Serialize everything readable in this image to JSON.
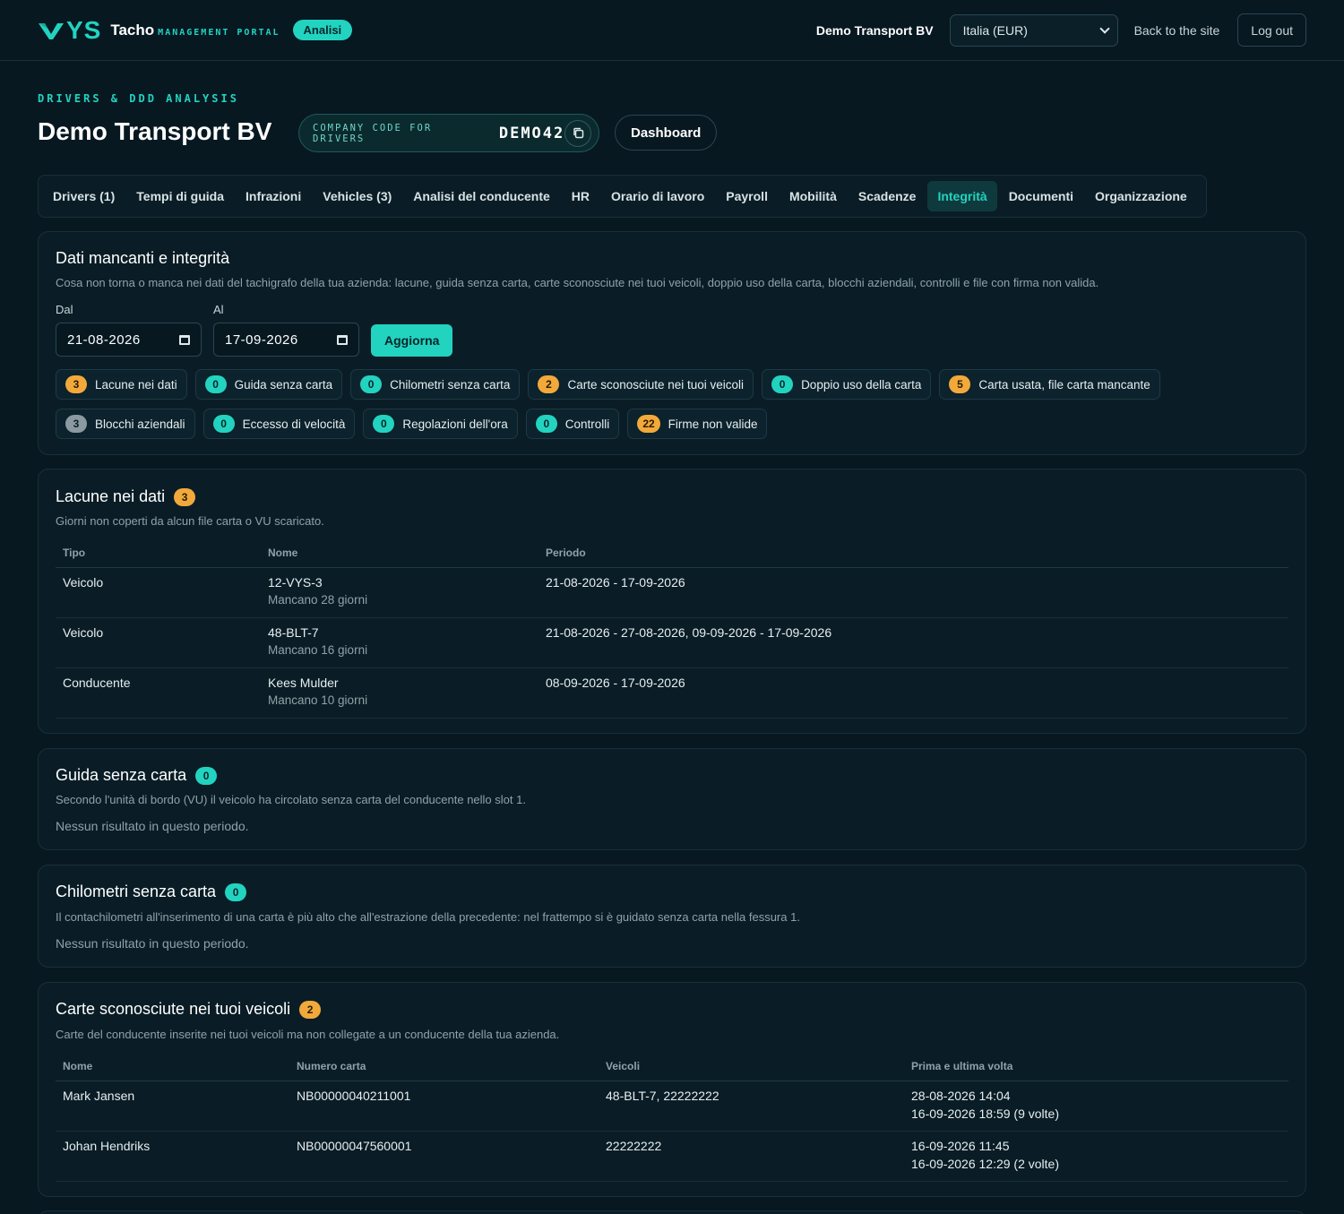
{
  "topbar": {
    "logo_text": "YS",
    "brand_name": "Tacho",
    "brand_sub": "MANAGEMENT PORTAL",
    "mode_pill": "Analisi",
    "company": "Demo Transport BV",
    "region_select": "Italia (EUR)",
    "back_link": "Back to the site",
    "logout": "Log out"
  },
  "header": {
    "eyebrow": "DRIVERS & DDD ANALYSIS",
    "title": "Demo Transport BV",
    "code_label": "COMPANY CODE FOR DRIVERS",
    "code_value": "DEMO42",
    "dashboard_button": "Dashboard"
  },
  "tabs": [
    {
      "label": "Drivers (1)",
      "active": false
    },
    {
      "label": "Tempi di guida",
      "active": false
    },
    {
      "label": "Infrazioni",
      "active": false
    },
    {
      "label": "Vehicles (3)",
      "active": false
    },
    {
      "label": "Analisi del conducente",
      "active": false
    },
    {
      "label": "HR",
      "active": false
    },
    {
      "label": "Orario di lavoro",
      "active": false
    },
    {
      "label": "Payroll",
      "active": false
    },
    {
      "label": "Mobilità",
      "active": false
    },
    {
      "label": "Scadenze",
      "active": false
    },
    {
      "label": "Integrità",
      "active": true
    },
    {
      "label": "Documenti",
      "active": false
    },
    {
      "label": "Organizzazione",
      "active": false
    }
  ],
  "integrity": {
    "title": "Dati mancanti e integrità",
    "description": "Cosa non torna o manca nei dati del tachigrafo della tua azienda: lacune, guida senza carta, carte sconosciute nei tuoi veicoli, doppio uso della carta, blocchi aziendali, controlli e file con firma non valida.",
    "from_label": "Dal",
    "from_value": "21-08-2026",
    "to_label": "Al",
    "to_value": "17-09-2026",
    "refresh_button": "Aggiorna",
    "chips": [
      {
        "count": "3",
        "label": "Lacune nei dati",
        "color": "orange"
      },
      {
        "count": "0",
        "label": "Guida senza carta",
        "color": "teal"
      },
      {
        "count": "0",
        "label": "Chilometri senza carta",
        "color": "teal"
      },
      {
        "count": "2",
        "label": "Carte sconosciute nei tuoi veicoli",
        "color": "orange"
      },
      {
        "count": "0",
        "label": "Doppio uso della carta",
        "color": "teal"
      },
      {
        "count": "5",
        "label": "Carta usata, file carta mancante",
        "color": "orange"
      },
      {
        "count": "3",
        "label": "Blocchi aziendali",
        "color": "gray"
      },
      {
        "count": "0",
        "label": "Eccesso di velocità",
        "color": "teal"
      },
      {
        "count": "0",
        "label": "Regolazioni dell'ora",
        "color": "teal"
      },
      {
        "count": "0",
        "label": "Controlli",
        "color": "teal"
      },
      {
        "count": "22",
        "label": "Firme non valide",
        "color": "orange"
      }
    ]
  },
  "gaps": {
    "title": "Lacune nei dati",
    "count": "3",
    "description": "Giorni non coperti da alcun file carta o VU scaricato.",
    "columns": [
      "Tipo",
      "Nome",
      "Periodo"
    ],
    "rows": [
      {
        "type": "Veicolo",
        "name": "12-VYS-3",
        "sub": "Mancano 28 giorni",
        "period": "21-08-2026 - 17-09-2026"
      },
      {
        "type": "Veicolo",
        "name": "48-BLT-7",
        "sub": "Mancano 16 giorni",
        "period": "21-08-2026 - 27-08-2026, 09-09-2026 - 17-09-2026"
      },
      {
        "type": "Conducente",
        "name": "Kees Mulder",
        "sub": "Mancano 10 giorni",
        "period": "08-09-2026 - 17-09-2026"
      }
    ]
  },
  "no_card": {
    "title": "Guida senza carta",
    "count": "0",
    "description": "Secondo l'unità di bordo (VU) il veicolo ha circolato senza carta del conducente nello slot 1.",
    "empty": "Nessun risultato in questo periodo."
  },
  "km_no_card": {
    "title": "Chilometri senza carta",
    "count": "0",
    "description": "Il contachilometri all'inserimento di una carta è più alto che all'estrazione della precedente: nel frattempo si è guidato senza carta nella fessura 1.",
    "empty": "Nessun risultato in questo periodo."
  },
  "unknown_cards": {
    "title": "Carte sconosciute nei tuoi veicoli",
    "count": "2",
    "description": "Carte del conducente inserite nei tuoi veicoli ma non collegate a un conducente della tua azienda.",
    "columns": [
      "Nome",
      "Numero carta",
      "Veicoli",
      "Prima e ultima volta"
    ],
    "rows": [
      {
        "name": "Mark Jansen",
        "card": "NB00000040211001",
        "vehicles": "48-BLT-7, 22222222",
        "first": "28-08-2026 14:04",
        "last": "16-09-2026 18:59 (9 volte)"
      },
      {
        "name": "Johan Hendriks",
        "card": "NB00000047560001",
        "vehicles": "22222222",
        "first": "16-09-2026 11:45",
        "last": "16-09-2026 12:29 (2 volte)"
      }
    ]
  }
}
